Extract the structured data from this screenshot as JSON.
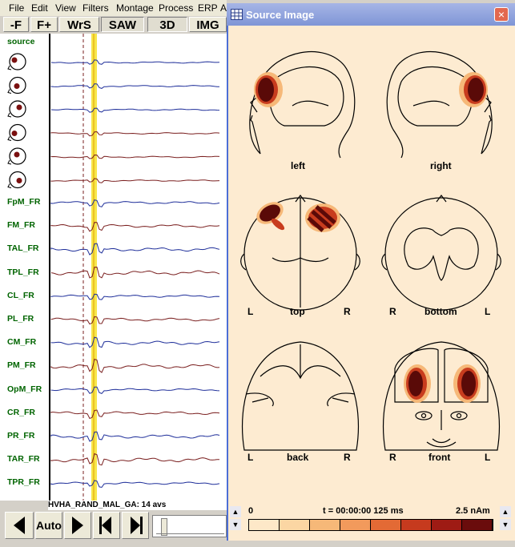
{
  "menubar": {
    "items": [
      "File",
      "Edit",
      "View",
      "Filters",
      "Montage",
      "Process",
      "ERP",
      "A"
    ]
  },
  "toolbar": {
    "buttons": [
      "-F",
      "F+",
      "WrS",
      "SAW",
      "3D",
      "IMG"
    ],
    "pressed": [
      false,
      false,
      false,
      true,
      true,
      false
    ]
  },
  "traces": {
    "source_label": "source",
    "labels": [
      "FpM_FR",
      "FM_FR",
      "TAL_FR",
      "TPL_FR",
      "CL_FR",
      "PL_FR",
      "CM_FR",
      "PM_FR",
      "OpM_FR",
      "CR_FR",
      "PR_FR",
      "TAR_FR",
      "TPR_FR"
    ],
    "source_line_color": "#1f2f9a",
    "channel_line_color": "#7a1f1f",
    "cursor_color": "#f7e64a"
  },
  "footer": {
    "dataset": "HVHA_RAND_MAL_GA: 14 avs",
    "auto_label": "Auto"
  },
  "source_window": {
    "title": "Source Image",
    "close_icon": "×",
    "views": {
      "left": "left",
      "right": "right",
      "top": "top",
      "top_L": "L",
      "top_R": "R",
      "bottom": "bottom",
      "bottom_R": "R",
      "bottom_L": "L",
      "back": "back",
      "back_L": "L",
      "back_R": "R",
      "front": "front",
      "front_R": "R",
      "front_L": "L"
    },
    "scale": {
      "min_label": "0",
      "time_label": "t = 00:00:00  125 ms",
      "max_label": "2.5 nAm",
      "colors": [
        "#fde8c8",
        "#fbd6a3",
        "#f6b878",
        "#f29a5c",
        "#e36a35",
        "#c63a1e",
        "#9e1b14",
        "#6a0c0c"
      ]
    },
    "colors": {
      "background": "#fdebd1",
      "blob_dark": "#5a0a08",
      "blob_mid": "#c83c1e",
      "blob_light": "#f6b878"
    }
  }
}
